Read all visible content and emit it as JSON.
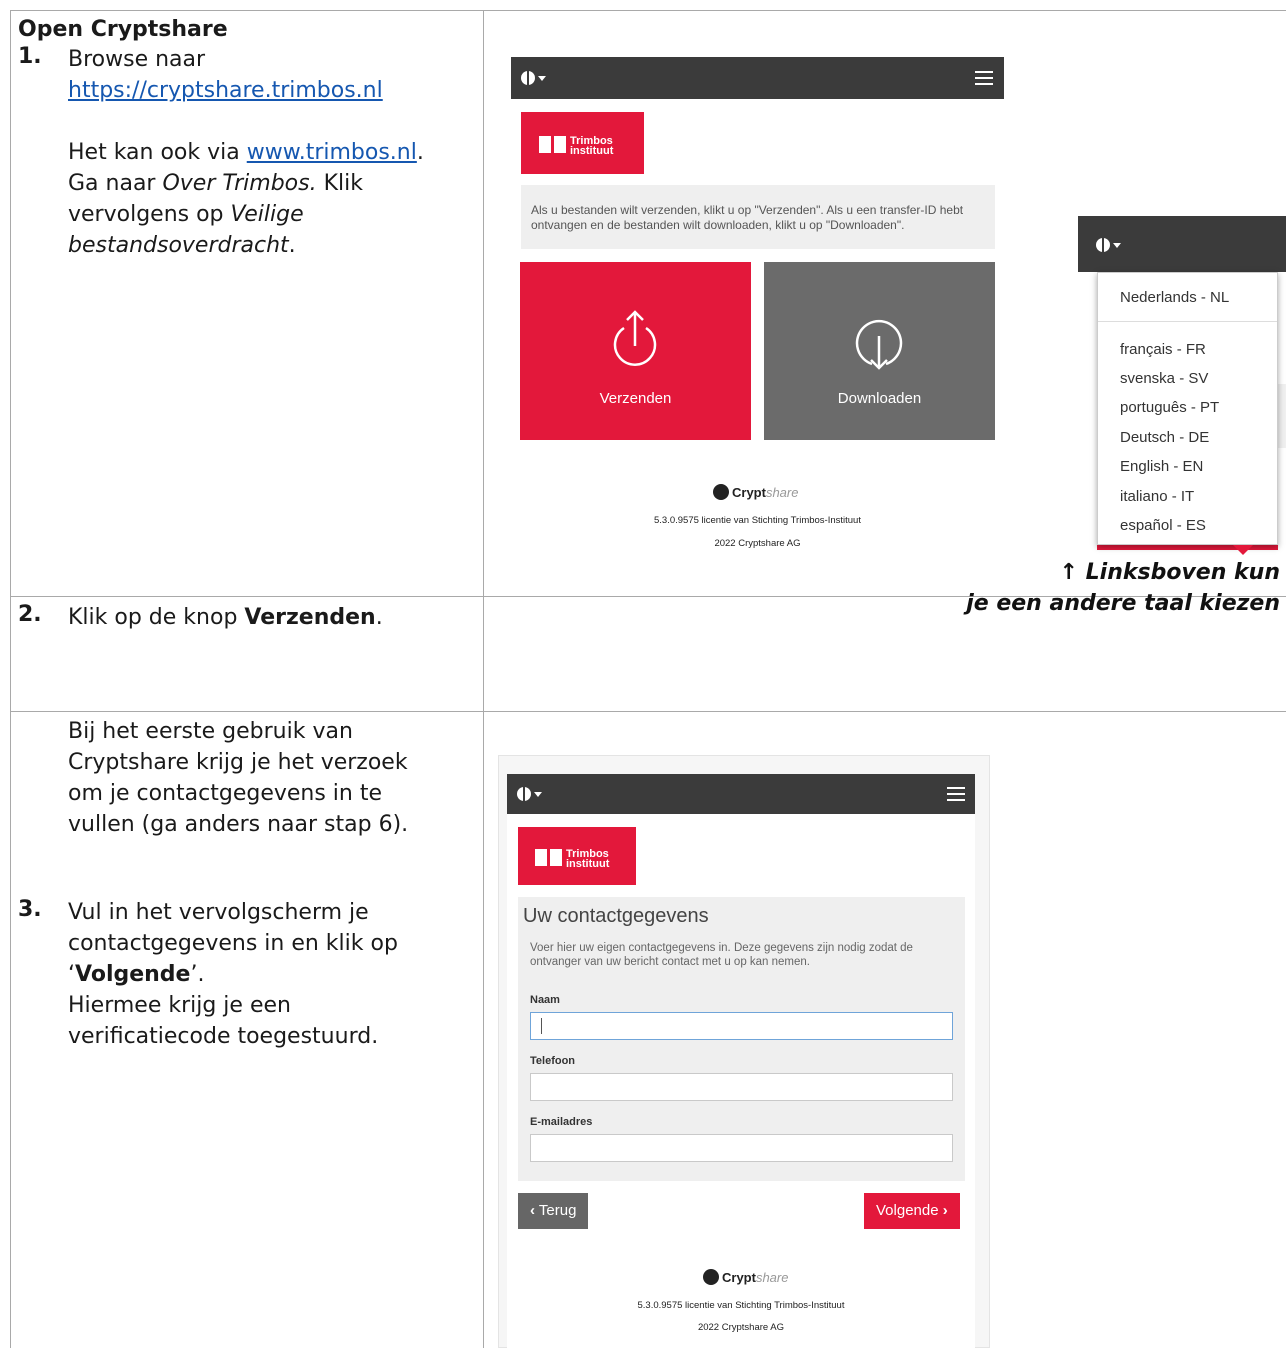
{
  "section": {
    "title": "Open Cryptshare"
  },
  "step1": {
    "number": "1.",
    "line1": "Browse naar",
    "url": "https://cryptshare.trimbos.nl",
    "alt_intro": "Het kan ook via ",
    "alt_url": "www.trimbos.nl",
    "alt_after": ".",
    "line_ga": "Ga naar ",
    "over": "Over Trimbos.",
    "klik": " Klik",
    "vervolgens": "vervolgens op ",
    "veilige": "Veilige",
    "bestand": "bestandsoverdracht",
    "period": "."
  },
  "step2": {
    "number": "2.",
    "text_before": "Klik op de knop ",
    "button_name": "Verzenden",
    "text_after": "."
  },
  "step3": {
    "intro_lines": [
      "Bij het eerste gebruik van",
      "Cryptshare krijg je het verzoek",
      "om je contactgegevens in te",
      "vullen (ga anders naar stap 6)."
    ],
    "number": "3.",
    "line1": "Vul in het vervolgscherm je",
    "line2": "contactgegevens in en klik op",
    "quote_open": "‘",
    "volgende": "Volgende",
    "quote_close": "’.",
    "line4": "Hiermee krijg je een",
    "line5": "verificatiecode toegestuurd."
  },
  "app": {
    "logo_line1": "Trimbos",
    "logo_line2": "instituut",
    "info_text": "Als u bestanden wilt verzenden, klikt u op \"Verzenden\". Als u een transfer-ID hebt ontvangen en de bestanden wilt downloaden, klikt u op \"Downloaden\".",
    "send_label": "Verzenden",
    "download_label": "Downloaden",
    "brand_crypt": "Crypt",
    "brand_share": "share",
    "license": "5.3.0.9575 licentie van Stichting Trimbos-Instituut",
    "copyright": "2022 Cryptshare AG",
    "colors": {
      "accent": "#e3183b",
      "dark": "#3b3b3b",
      "tile_gray": "#6b6b6b"
    }
  },
  "languages": {
    "items": [
      "Nederlands - NL",
      "français - FR",
      "svenska - SV",
      "português - PT",
      "Deutsch - DE",
      "English - EN",
      "italiano - IT",
      "español - ES"
    ],
    "caption_line1": "Linksboven kun",
    "caption_line2": "je een andere taal kiezen",
    "arrow": "↑"
  },
  "form": {
    "title": "Uw contactgegevens",
    "description": "Voer hier uw eigen contactgegevens in. Deze gegevens zijn nodig zodat de ontvanger van uw bericht contact met u op kan nemen.",
    "name_label": "Naam",
    "phone_label": "Telefoon",
    "email_label": "E-mailadres",
    "back_label": "Terug",
    "next_label": "Volgende"
  },
  "icons": [
    "globe-icon",
    "caret-down-icon",
    "menu-icon",
    "upload-icon",
    "download-icon",
    "cryptshare-logo-icon",
    "chevron-left-icon",
    "chevron-right-icon",
    "arrow-up-icon"
  ]
}
